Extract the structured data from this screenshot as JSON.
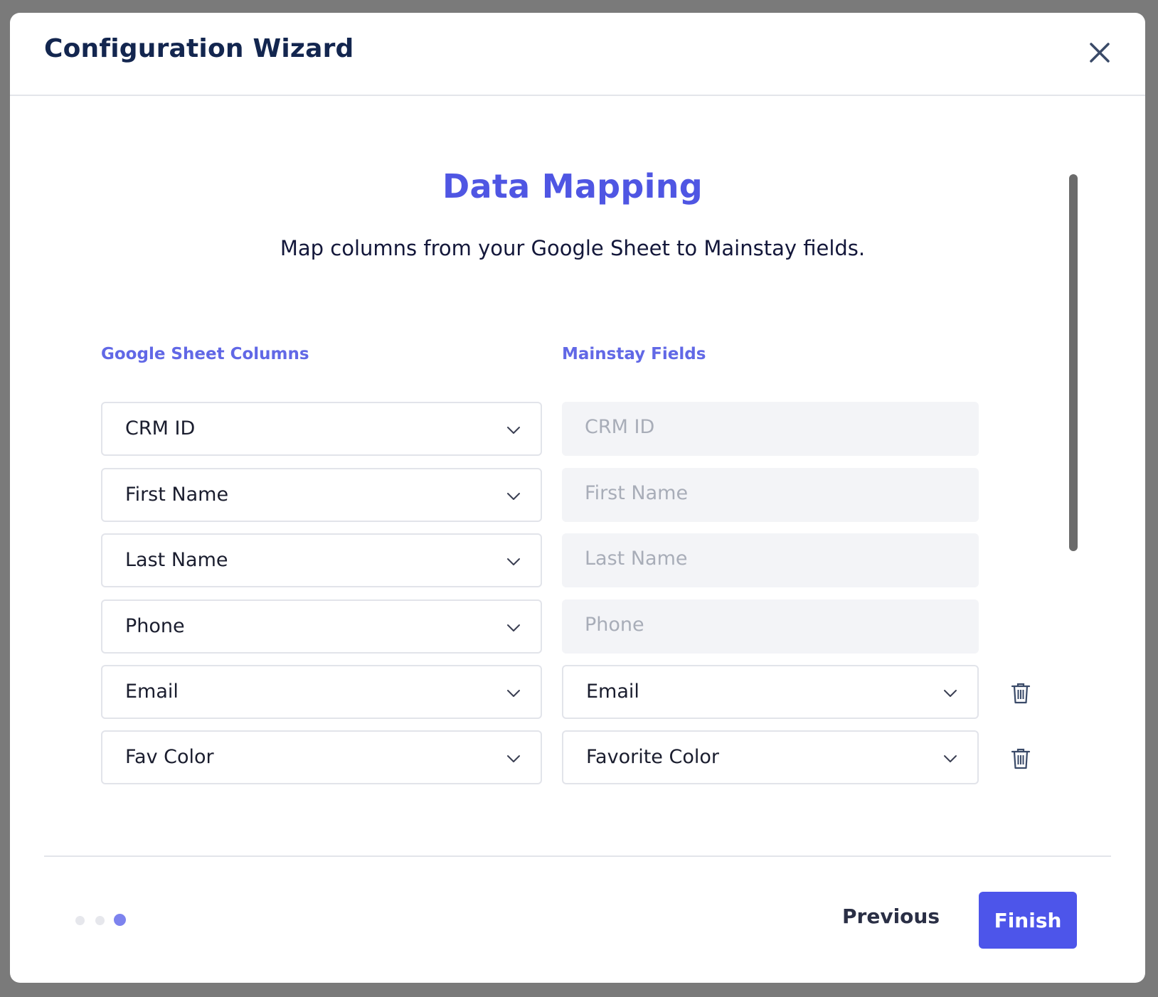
{
  "modal": {
    "title": "Configuration Wizard"
  },
  "step": {
    "title": "Data Mapping",
    "subtitle": "Map columns from your Google Sheet to Mainstay fields."
  },
  "columns": {
    "left_header": "Google Sheet Columns",
    "right_header": "Mainstay Fields"
  },
  "rows": [
    {
      "sheet_column": "CRM ID",
      "mainstay_field": "CRM ID",
      "field_editable": false
    },
    {
      "sheet_column": "First Name",
      "mainstay_field": "First Name",
      "field_editable": false
    },
    {
      "sheet_column": "Last Name",
      "mainstay_field": "Last Name",
      "field_editable": false
    },
    {
      "sheet_column": "Phone",
      "mainstay_field": "Phone",
      "field_editable": false
    },
    {
      "sheet_column": "Email",
      "mainstay_field": "Email",
      "field_editable": true
    },
    {
      "sheet_column": "Fav Color",
      "mainstay_field": "Favorite Color",
      "field_editable": true
    }
  ],
  "footer": {
    "previous_label": "Previous",
    "finish_label": "Finish",
    "steps_total": 3,
    "current_step": 3
  },
  "colors": {
    "accent": "#4d55ea",
    "title_text": "#13264f",
    "header_link": "#6168e6",
    "dot_inactive": "#e6e7ec",
    "dot_active": "#7d83ee"
  },
  "icons": {
    "close": "close-icon",
    "chevron": "chevron-down-icon",
    "delete": "trash-icon"
  }
}
